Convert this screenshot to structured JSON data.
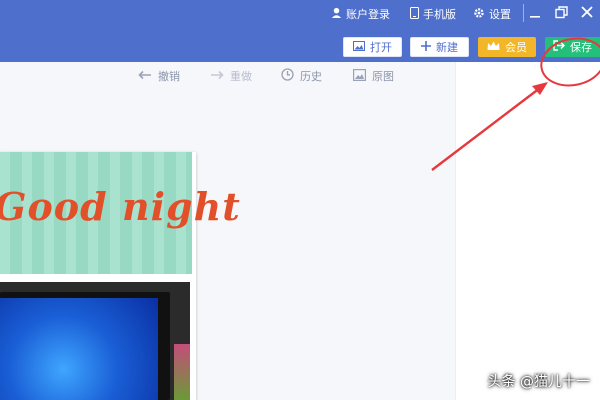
{
  "topbar": {
    "account_login": "账户登录",
    "mobile": "手机版",
    "settings": "设置"
  },
  "toolbar": {
    "open_label": "打开",
    "new_label": "新建",
    "vip_label": "会员",
    "save_label": "保存"
  },
  "edit_tools": {
    "undo": "撤销",
    "redo": "重做",
    "history": "历史",
    "original": "原图"
  },
  "canvas": {
    "banner_text": "Good night"
  },
  "watermark": "头条 @猫儿十一",
  "colors": {
    "header_blue": "#4f6fcd",
    "save_green": "#24c07a",
    "vip_gold": "#f2b628",
    "annotation_red": "#e6383d"
  },
  "icons": [
    "user-icon",
    "phone-icon",
    "gear-icon",
    "minimize-icon",
    "restore-icon",
    "close-icon",
    "image-icon",
    "plus-icon",
    "crown-icon",
    "exit-icon",
    "undo-arrow-icon",
    "redo-arrow-icon",
    "clock-icon",
    "picture-icon"
  ]
}
